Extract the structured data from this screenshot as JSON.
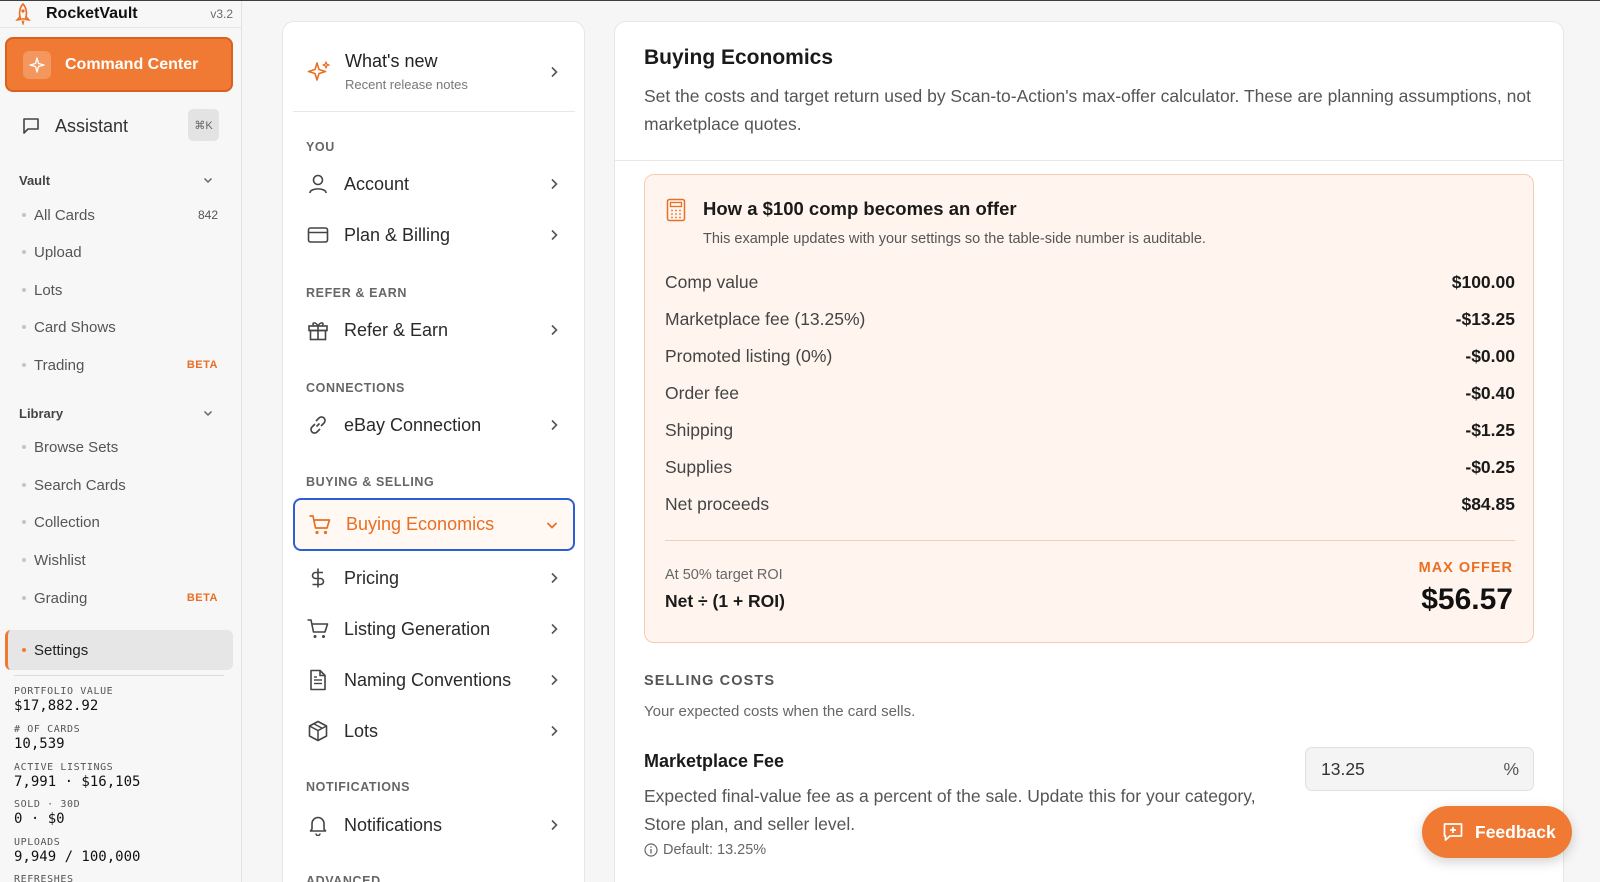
{
  "app": {
    "name": "RocketVault",
    "version": "v3.2"
  },
  "sidebar": {
    "command_center": "Command Center",
    "assistant": {
      "label": "Assistant",
      "shortcut": "⌘K"
    },
    "vault": {
      "label": "Vault",
      "items": [
        {
          "label": "All Cards",
          "badge": "842"
        },
        {
          "label": "Upload",
          "badge": ""
        },
        {
          "label": "Lots",
          "badge": ""
        },
        {
          "label": "Card Shows",
          "badge": ""
        },
        {
          "label": "Trading",
          "badge": "BETA"
        }
      ]
    },
    "library": {
      "label": "Library",
      "items": [
        {
          "label": "Browse Sets",
          "badge": ""
        },
        {
          "label": "Search Cards",
          "badge": ""
        },
        {
          "label": "Collection",
          "badge": ""
        },
        {
          "label": "Wishlist",
          "badge": ""
        },
        {
          "label": "Grading",
          "badge": "BETA"
        }
      ]
    },
    "settings": "Settings",
    "stats": [
      {
        "label": "PORTFOLIO VALUE",
        "value": "$17,882.92"
      },
      {
        "label": "# OF CARDS",
        "value": "10,539"
      },
      {
        "label": "ACTIVE LISTINGS",
        "value": "7,991 · $16,105"
      },
      {
        "label": "SOLD · 30D",
        "value": "0 · $0"
      },
      {
        "label": "UPLOADS",
        "value": "9,949 / 100,000"
      },
      {
        "label": "REFRESHES",
        "value": ""
      }
    ]
  },
  "menu": {
    "whats_new": {
      "title": "What's new",
      "subtitle": "Recent release notes"
    },
    "sections": {
      "you": "YOU",
      "refer": "REFER & EARN",
      "connections": "CONNECTIONS",
      "buying_selling": "BUYING & SELLING",
      "notifications": "NOTIFICATIONS",
      "advanced": "ADVANCED"
    },
    "items": {
      "account": "Account",
      "plan_billing": "Plan & Billing",
      "refer_earn": "Refer & Earn",
      "ebay": "eBay Connection",
      "buying_economics": "Buying Economics",
      "pricing": "Pricing",
      "listing_generation": "Listing Generation",
      "naming_conventions": "Naming Conventions",
      "lots": "Lots",
      "notifications": "Notifications"
    }
  },
  "main": {
    "title": "Buying Economics",
    "description": "Set the costs and target return used by Scan-to-Action's max-offer calculator. These are planning assumptions, not marketplace quotes.",
    "example": {
      "title": "How a $100 comp becomes an offer",
      "subtitle": "This example updates with your settings so the table-side number is auditable.",
      "rows": [
        {
          "label": "Comp value",
          "value": "$100.00"
        },
        {
          "label": "Marketplace fee (13.25%)",
          "value": "-$13.25"
        },
        {
          "label": "Promoted listing (0%)",
          "value": "-$0.00"
        },
        {
          "label": "Order fee",
          "value": "-$0.40"
        },
        {
          "label": "Shipping",
          "value": "-$1.25"
        },
        {
          "label": "Supplies",
          "value": "-$0.25"
        },
        {
          "label": "Net proceeds",
          "value": "$84.85"
        }
      ],
      "roi_label": "At 50% target ROI",
      "formula": "Net ÷ (1 + ROI)",
      "max_offer_label": "MAX OFFER",
      "max_offer_value": "$56.57"
    },
    "selling_costs": {
      "heading": "SELLING COSTS",
      "subheading": "Your expected costs when the card sells.",
      "marketplace_fee": {
        "title": "Marketplace Fee",
        "description": "Expected final-value fee as a percent of the sale. Update this for your category, Store plan, and seller level.",
        "default": "Default: 13.25%",
        "value": "13.25",
        "unit": "%"
      }
    }
  },
  "feedback": "Feedback",
  "colors": {
    "accent": "#f07a33",
    "focus": "#2c5fd6"
  }
}
